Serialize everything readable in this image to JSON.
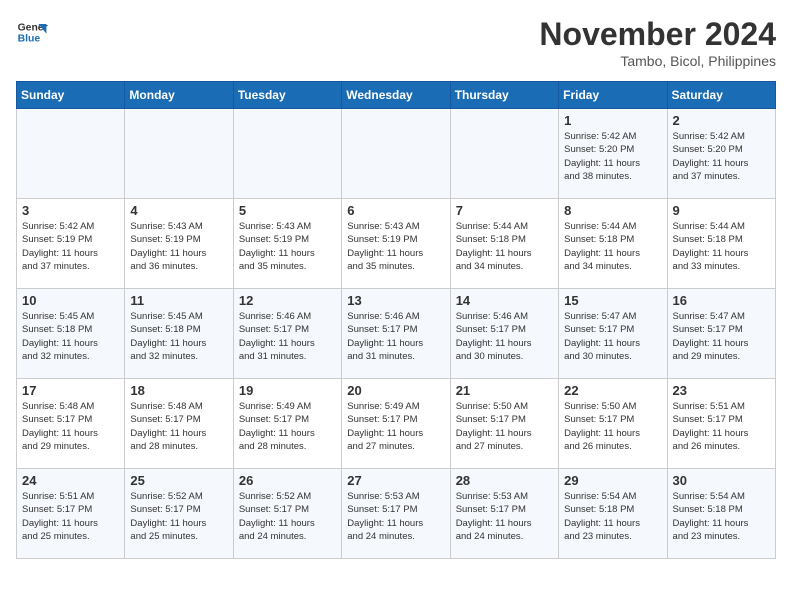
{
  "header": {
    "logo_line1": "General",
    "logo_line2": "Blue",
    "month_year": "November 2024",
    "location": "Tambo, Bicol, Philippines"
  },
  "days_of_week": [
    "Sunday",
    "Monday",
    "Tuesday",
    "Wednesday",
    "Thursday",
    "Friday",
    "Saturday"
  ],
  "weeks": [
    [
      {
        "day": "",
        "detail": ""
      },
      {
        "day": "",
        "detail": ""
      },
      {
        "day": "",
        "detail": ""
      },
      {
        "day": "",
        "detail": ""
      },
      {
        "day": "",
        "detail": ""
      },
      {
        "day": "1",
        "detail": "Sunrise: 5:42 AM\nSunset: 5:20 PM\nDaylight: 11 hours\nand 38 minutes."
      },
      {
        "day": "2",
        "detail": "Sunrise: 5:42 AM\nSunset: 5:20 PM\nDaylight: 11 hours\nand 37 minutes."
      }
    ],
    [
      {
        "day": "3",
        "detail": "Sunrise: 5:42 AM\nSunset: 5:19 PM\nDaylight: 11 hours\nand 37 minutes."
      },
      {
        "day": "4",
        "detail": "Sunrise: 5:43 AM\nSunset: 5:19 PM\nDaylight: 11 hours\nand 36 minutes."
      },
      {
        "day": "5",
        "detail": "Sunrise: 5:43 AM\nSunset: 5:19 PM\nDaylight: 11 hours\nand 35 minutes."
      },
      {
        "day": "6",
        "detail": "Sunrise: 5:43 AM\nSunset: 5:19 PM\nDaylight: 11 hours\nand 35 minutes."
      },
      {
        "day": "7",
        "detail": "Sunrise: 5:44 AM\nSunset: 5:18 PM\nDaylight: 11 hours\nand 34 minutes."
      },
      {
        "day": "8",
        "detail": "Sunrise: 5:44 AM\nSunset: 5:18 PM\nDaylight: 11 hours\nand 34 minutes."
      },
      {
        "day": "9",
        "detail": "Sunrise: 5:44 AM\nSunset: 5:18 PM\nDaylight: 11 hours\nand 33 minutes."
      }
    ],
    [
      {
        "day": "10",
        "detail": "Sunrise: 5:45 AM\nSunset: 5:18 PM\nDaylight: 11 hours\nand 32 minutes."
      },
      {
        "day": "11",
        "detail": "Sunrise: 5:45 AM\nSunset: 5:18 PM\nDaylight: 11 hours\nand 32 minutes."
      },
      {
        "day": "12",
        "detail": "Sunrise: 5:46 AM\nSunset: 5:17 PM\nDaylight: 11 hours\nand 31 minutes."
      },
      {
        "day": "13",
        "detail": "Sunrise: 5:46 AM\nSunset: 5:17 PM\nDaylight: 11 hours\nand 31 minutes."
      },
      {
        "day": "14",
        "detail": "Sunrise: 5:46 AM\nSunset: 5:17 PM\nDaylight: 11 hours\nand 30 minutes."
      },
      {
        "day": "15",
        "detail": "Sunrise: 5:47 AM\nSunset: 5:17 PM\nDaylight: 11 hours\nand 30 minutes."
      },
      {
        "day": "16",
        "detail": "Sunrise: 5:47 AM\nSunset: 5:17 PM\nDaylight: 11 hours\nand 29 minutes."
      }
    ],
    [
      {
        "day": "17",
        "detail": "Sunrise: 5:48 AM\nSunset: 5:17 PM\nDaylight: 11 hours\nand 29 minutes."
      },
      {
        "day": "18",
        "detail": "Sunrise: 5:48 AM\nSunset: 5:17 PM\nDaylight: 11 hours\nand 28 minutes."
      },
      {
        "day": "19",
        "detail": "Sunrise: 5:49 AM\nSunset: 5:17 PM\nDaylight: 11 hours\nand 28 minutes."
      },
      {
        "day": "20",
        "detail": "Sunrise: 5:49 AM\nSunset: 5:17 PM\nDaylight: 11 hours\nand 27 minutes."
      },
      {
        "day": "21",
        "detail": "Sunrise: 5:50 AM\nSunset: 5:17 PM\nDaylight: 11 hours\nand 27 minutes."
      },
      {
        "day": "22",
        "detail": "Sunrise: 5:50 AM\nSunset: 5:17 PM\nDaylight: 11 hours\nand 26 minutes."
      },
      {
        "day": "23",
        "detail": "Sunrise: 5:51 AM\nSunset: 5:17 PM\nDaylight: 11 hours\nand 26 minutes."
      }
    ],
    [
      {
        "day": "24",
        "detail": "Sunrise: 5:51 AM\nSunset: 5:17 PM\nDaylight: 11 hours\nand 25 minutes."
      },
      {
        "day": "25",
        "detail": "Sunrise: 5:52 AM\nSunset: 5:17 PM\nDaylight: 11 hours\nand 25 minutes."
      },
      {
        "day": "26",
        "detail": "Sunrise: 5:52 AM\nSunset: 5:17 PM\nDaylight: 11 hours\nand 24 minutes."
      },
      {
        "day": "27",
        "detail": "Sunrise: 5:53 AM\nSunset: 5:17 PM\nDaylight: 11 hours\nand 24 minutes."
      },
      {
        "day": "28",
        "detail": "Sunrise: 5:53 AM\nSunset: 5:17 PM\nDaylight: 11 hours\nand 24 minutes."
      },
      {
        "day": "29",
        "detail": "Sunrise: 5:54 AM\nSunset: 5:18 PM\nDaylight: 11 hours\nand 23 minutes."
      },
      {
        "day": "30",
        "detail": "Sunrise: 5:54 AM\nSunset: 5:18 PM\nDaylight: 11 hours\nand 23 minutes."
      }
    ]
  ]
}
